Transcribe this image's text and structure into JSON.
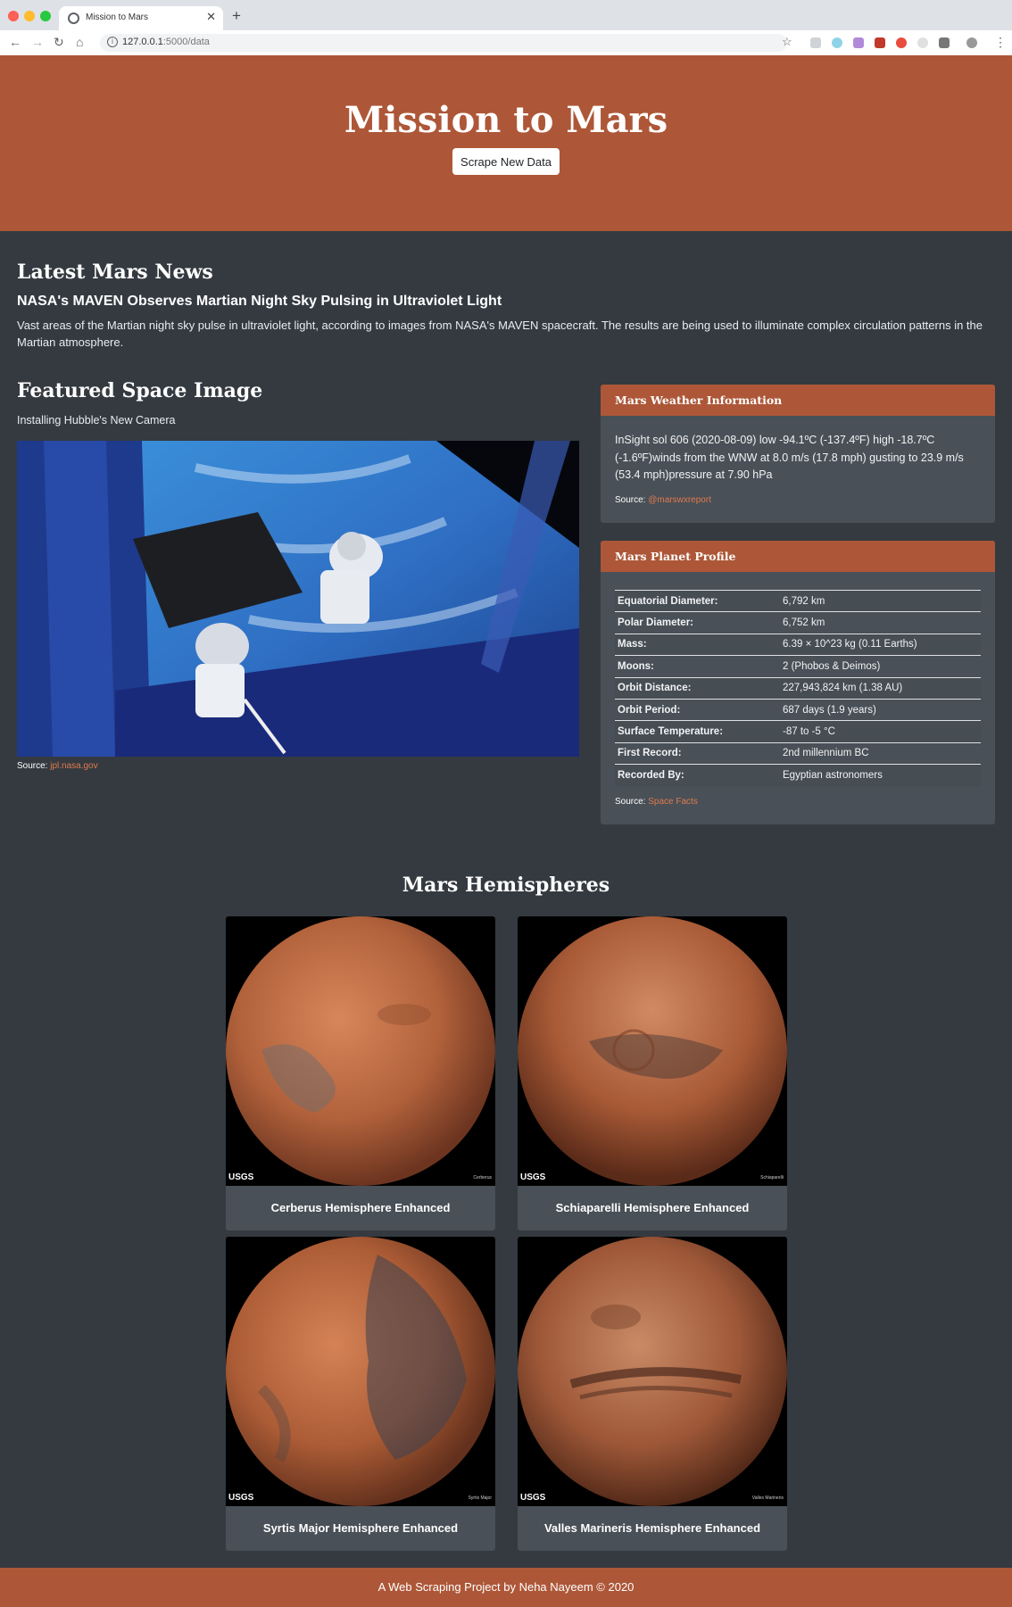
{
  "browser": {
    "tab_title": "Mission to Mars",
    "url_host": "127.0.0.1",
    "url_path": ":5000/data"
  },
  "header": {
    "title": "Mission to Mars",
    "button_label": "Scrape New Data"
  },
  "news": {
    "heading": "Latest Mars News",
    "title": "NASA's MAVEN Observes Martian Night Sky Pulsing in Ultraviolet Light",
    "paragraph": "Vast areas of the Martian night sky pulse in ultraviolet light, according to images from NASA's MAVEN spacecraft. The results are being used to illuminate complex circulation patterns in the Martian atmosphere."
  },
  "featured": {
    "heading": "Featured Space Image",
    "caption": "Installing Hubble's New Camera",
    "source_label": "Source:",
    "source_link": "jpl.nasa.gov"
  },
  "weather": {
    "heading": "Mars Weather Information",
    "text": "InSight sol 606 (2020-08-09) low -94.1ºC (-137.4ºF) high -18.7ºC (-1.6ºF)winds from the WNW at 8.0 m/s (17.8 mph) gusting to 23.9 m/s (53.4 mph)pressure at 7.90 hPa",
    "source_label": "Source:",
    "source_link": "@marswxreport"
  },
  "profile": {
    "heading": "Mars Planet Profile",
    "rows": [
      {
        "key": "Equatorial Diameter:",
        "value": "6,792 km"
      },
      {
        "key": "Polar Diameter:",
        "value": "6,752 km"
      },
      {
        "key": "Mass:",
        "value": "6.39 × 10^23 kg (0.11 Earths)"
      },
      {
        "key": "Moons:",
        "value": "2 (Phobos & Deimos)"
      },
      {
        "key": "Orbit Distance:",
        "value": "227,943,824 km (1.38 AU)"
      },
      {
        "key": "Orbit Period:",
        "value": "687 days (1.9 years)"
      },
      {
        "key": "Surface Temperature:",
        "value": "-87 to -5 °C"
      },
      {
        "key": "First Record:",
        "value": "2nd millennium BC"
      },
      {
        "key": "Recorded By:",
        "value": "Egyptian astronomers"
      }
    ],
    "source_label": "Source:",
    "source_link": "Space Facts"
  },
  "hemispheres": {
    "heading": "Mars Hemispheres",
    "usgs_mark": "USGS",
    "items": [
      {
        "title": "Cerberus Hemisphere Enhanced",
        "tag": "Cerberus"
      },
      {
        "title": "Schiaparelli Hemisphere Enhanced",
        "tag": "Schiaparelli"
      },
      {
        "title": "Syrtis Major Hemisphere Enhanced",
        "tag": "Syrtis Major"
      },
      {
        "title": "Valles Marineris Hemisphere Enhanced",
        "tag": "Valles Marineris"
      }
    ]
  },
  "footer": {
    "text": "A Web Scraping Project by Neha Nayeem © 2020"
  }
}
